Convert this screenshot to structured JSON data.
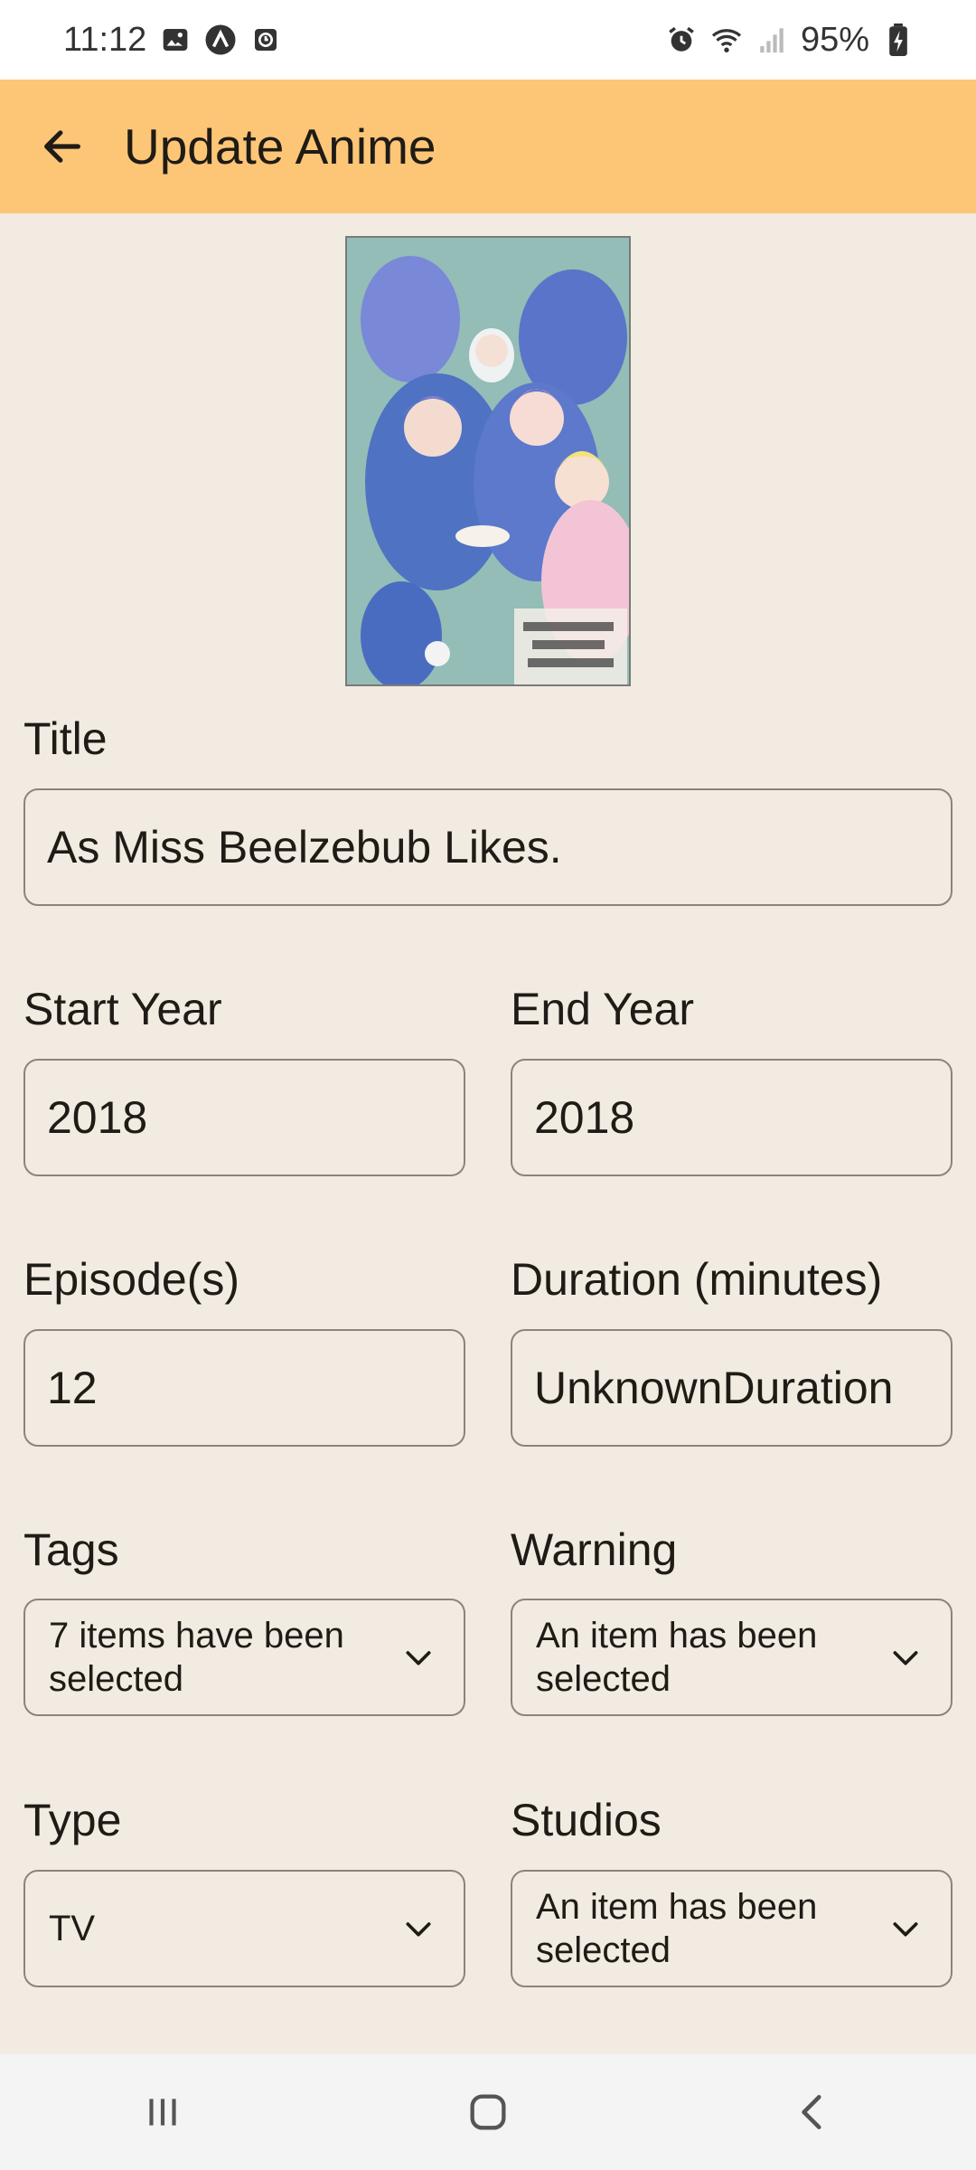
{
  "status_bar": {
    "time": "11:12",
    "battery": "95%",
    "left_icons": [
      "gallery-icon",
      "app-a-icon",
      "clock-app-icon"
    ],
    "right_icons": [
      "alarm-icon",
      "wifi-icon",
      "signal-icon",
      "battery-charging-icon"
    ]
  },
  "app_bar": {
    "title": "Update Anime",
    "back_icon": "arrow-left-icon",
    "color": "#fdc677"
  },
  "form": {
    "title": {
      "label": "Title",
      "value": "As Miss Beelzebub Likes."
    },
    "start_year": {
      "label": "Start Year",
      "value": "2018"
    },
    "end_year": {
      "label": "End Year",
      "value": "2018"
    },
    "episodes": {
      "label": "Episode(s)",
      "value": "12"
    },
    "duration": {
      "label": "Duration (minutes)",
      "value": "UnknownDuration"
    },
    "tags": {
      "label": "Tags",
      "value": "7 items have been selected"
    },
    "warning": {
      "label": "Warning",
      "value": "An item has been selected"
    },
    "type": {
      "label": "Type",
      "value": "TV"
    },
    "studios": {
      "label": "Studios",
      "value": "An item has been selected"
    }
  },
  "nav_bar": {
    "buttons": [
      "recent-apps-icon",
      "home-icon",
      "back-nav-icon"
    ]
  }
}
